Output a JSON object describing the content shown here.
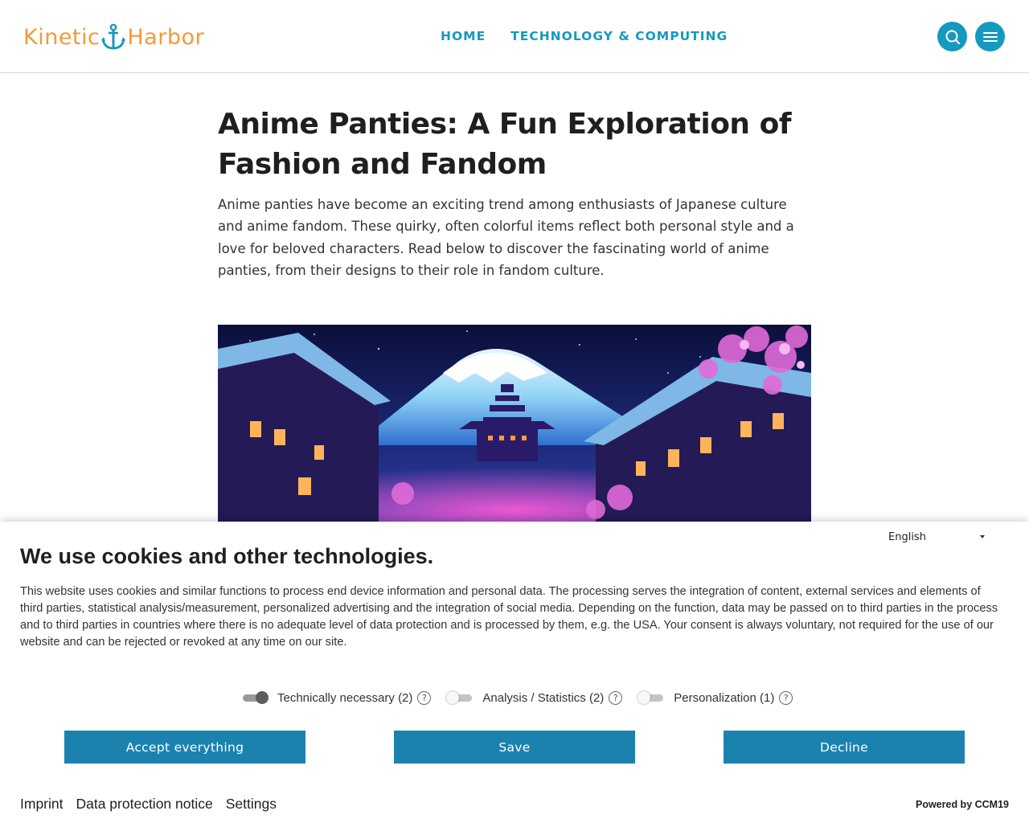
{
  "header": {
    "logo": {
      "part1": "Kinetic",
      "part2": "Harbor",
      "icon": "anchor-icon"
    },
    "nav": [
      "HOME",
      "TECHNOLOGY & COMPUTING"
    ],
    "search_icon": "search-icon",
    "menu_icon": "hamburger-menu-icon",
    "accent_color": "#1699be",
    "logo_color": "#f39a3b"
  },
  "article": {
    "title": "Anime Panties: A Fun Exploration of Fashion and Fandom",
    "intro": "Anime panties have become an exciting trend among enthusiasts of Japanese culture and anime fandom. These quirky, often colorful items reflect both personal style and a love for beloved characters. Read below to discover the fascinating world of anime panties, from their designs to their role in fandom culture."
  },
  "cookie_banner": {
    "language": "English",
    "title": "We use cookies and other technologies.",
    "text": "This website uses cookies and similar functions to process end device information and personal data. The processing serves the integration of content, external services and elements of third parties, statistical analysis/measurement, personalized advertising and the integration of social media. Depending on the function, data may be passed on to third parties in the process and to third parties in countries where there is no adequate level of data protection and is processed by them, e.g. the USA. Your consent is always voluntary, not required for the use of our website and can be rejected or revoked at any time on our site.",
    "toggles": [
      {
        "label": "Technically necessary (2)",
        "on": true
      },
      {
        "label": "Analysis / Statistics (2)",
        "on": false
      },
      {
        "label": "Personalization (1)",
        "on": false
      }
    ],
    "help_symbol": "?",
    "buttons": {
      "accept": "Accept everything",
      "save": "Save",
      "decline": "Decline"
    },
    "button_color": "#1b82b0",
    "links": [
      "Imprint",
      "Data protection notice",
      "Settings"
    ],
    "powered_by": "Powered by CCM19"
  }
}
